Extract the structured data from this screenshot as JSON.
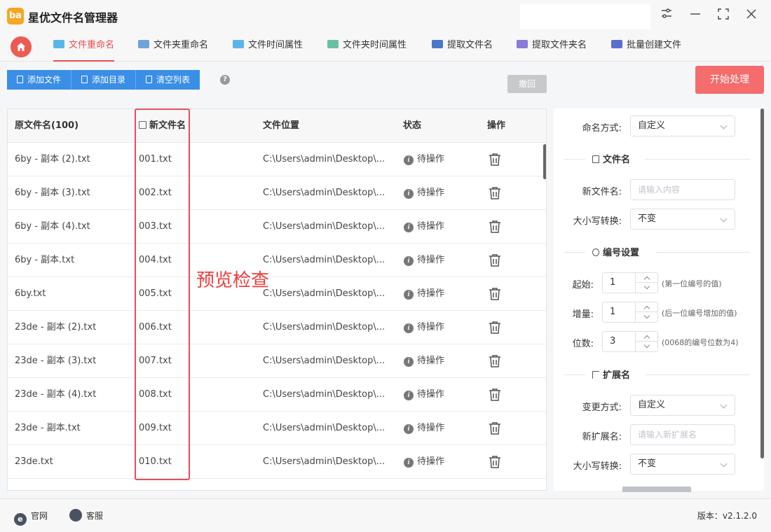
{
  "app": {
    "title": "星优文件名管理器",
    "logo_text": "ba"
  },
  "window_controls": {
    "settings": "⚙",
    "minimize": "—",
    "maximize": "⛶",
    "close": "✕"
  },
  "tabs": [
    {
      "label": "文件重命名",
      "color": "#e84d4d"
    },
    {
      "label": "文件夹重命名",
      "color": "#6fa3d8"
    },
    {
      "label": "文件时间属性",
      "color": "#5bb6e8"
    },
    {
      "label": "文件夹时间属性",
      "color": "#6cc0a0"
    },
    {
      "label": "提取文件名",
      "color": "#4a78c8"
    },
    {
      "label": "提取文件夹名",
      "color": "#8b7ad6"
    },
    {
      "label": "批量创建文件",
      "color": "#5a6fd0"
    }
  ],
  "toolbar": {
    "add_file": "添加文件",
    "add_dir": "添加目录",
    "clear_list": "清空列表",
    "help": "?",
    "undo": "撤回",
    "start": "开始处理"
  },
  "table": {
    "headers": {
      "original": "原文件名(100)",
      "new_name": "新文件名",
      "location": "文件位置",
      "status": "状态",
      "action": "操作"
    },
    "rows": [
      {
        "original": "6by - 副本 (2).txt",
        "new_name": "001.txt",
        "location": "C:\\Users\\admin\\Desktop\\...",
        "status": "待操作"
      },
      {
        "original": "6by - 副本 (3).txt",
        "new_name": "002.txt",
        "location": "C:\\Users\\admin\\Desktop\\...",
        "status": "待操作"
      },
      {
        "original": "6by - 副本 (4).txt",
        "new_name": "003.txt",
        "location": "C:\\Users\\admin\\Desktop\\...",
        "status": "待操作"
      },
      {
        "original": "6by - 副本.txt",
        "new_name": "004.txt",
        "location": "C:\\Users\\admin\\Desktop\\...",
        "status": "待操作"
      },
      {
        "original": "6by.txt",
        "new_name": "005.txt",
        "location": "C:\\Users\\admin\\Desktop\\...",
        "status": "待操作"
      },
      {
        "original": "23de - 副本 (2).txt",
        "new_name": "006.txt",
        "location": "C:\\Users\\admin\\Desktop\\...",
        "status": "待操作"
      },
      {
        "original": "23de - 副本 (3).txt",
        "new_name": "007.txt",
        "location": "C:\\Users\\admin\\Desktop\\...",
        "status": "待操作"
      },
      {
        "original": "23de - 副本 (4).txt",
        "new_name": "008.txt",
        "location": "C:\\Users\\admin\\Desktop\\...",
        "status": "待操作"
      },
      {
        "original": "23de - 副本.txt",
        "new_name": "009.txt",
        "location": "C:\\Users\\admin\\Desktop\\...",
        "status": "待操作"
      },
      {
        "original": "23de.txt",
        "new_name": "010.txt",
        "location": "C:\\Users\\admin\\Desktop\\...",
        "status": "待操作"
      }
    ],
    "status_icon": "i"
  },
  "annotation": {
    "text": "预览检查",
    "color": "#e84d5b"
  },
  "settings": {
    "naming_mode_label": "命名方式:",
    "naming_mode_value": "自定义",
    "filename_section": "文件名",
    "new_filename_label": "新文件名:",
    "new_filename_placeholder": "请输入内容",
    "case_label": "大小写转换:",
    "case_value": "不变",
    "numbering_section": "编号设置",
    "start_label": "起始:",
    "start_value": "1",
    "start_hint": "(第一位编号的值)",
    "increment_label": "增量:",
    "increment_value": "1",
    "increment_hint": "(后一位编号增加的值)",
    "digits_label": "位数:",
    "digits_value": "3",
    "digits_hint": "(0068的编号位数为4)",
    "extension_section": "扩展名",
    "change_mode_label": "变更方式:",
    "change_mode_value": "自定义",
    "new_ext_label": "新扩展名:",
    "new_ext_placeholder": "请输入新扩展名",
    "ext_case_label": "大小写转换:",
    "ext_case_value": "不变"
  },
  "footer": {
    "website": "官网",
    "website_icon": "e",
    "support": "客服",
    "version": "版本：v2.1.2.0"
  },
  "colors": {
    "accent": "#e84d4d",
    "primary_blue": "#3a8ee6",
    "start_red": "#f56c6c"
  }
}
